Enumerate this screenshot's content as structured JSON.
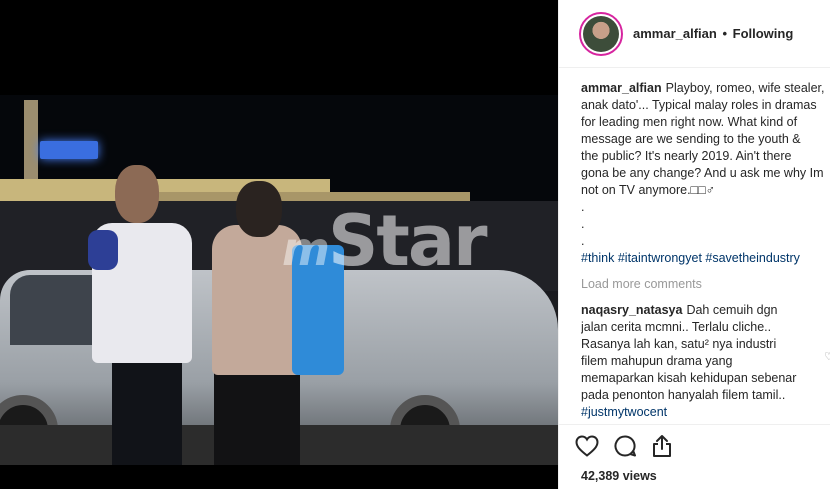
{
  "post": {
    "username": "ammar_alfian",
    "separator": "•",
    "follow_status": "Following"
  },
  "caption": {
    "username": "ammar_alfian",
    "lines": [
      "Playboy, romeo, wife stealer,",
      "anak dato'... Typical malay roles in dramas",
      "for leading men right now. What kind of",
      "message are we sending to the youth &",
      "the public? It's nearly 2019. Ain't there",
      "gona be any change? And u ask me why Im",
      "not on TV anymore.□□♂",
      ".",
      ".",
      "."
    ],
    "hashtags": [
      "#think",
      "#itaintwrongyet",
      "#savetheindustry"
    ]
  },
  "load_more_label": "Load more comments",
  "comment": {
    "username": "naqasry_natasya",
    "lines": [
      "Dah cemuih dgn",
      "jalan cerita mcmni.. Terlalu cliche..",
      "Rasanya lah kan, satu² nya industri",
      "filem mahupun drama yang",
      "memaparkan kisah kehidupan sebenar",
      "pada penonton hanyalah filem tamil.."
    ],
    "hashtag": "#justmytwocent",
    "like_icon": "♡"
  },
  "actions": {
    "like_icon": "heart-icon",
    "comment_icon": "comment-icon",
    "share_icon": "share-icon"
  },
  "views_label": "42,389 views",
  "media": {
    "watermark_prefix": "m",
    "watermark_text": "Star"
  }
}
